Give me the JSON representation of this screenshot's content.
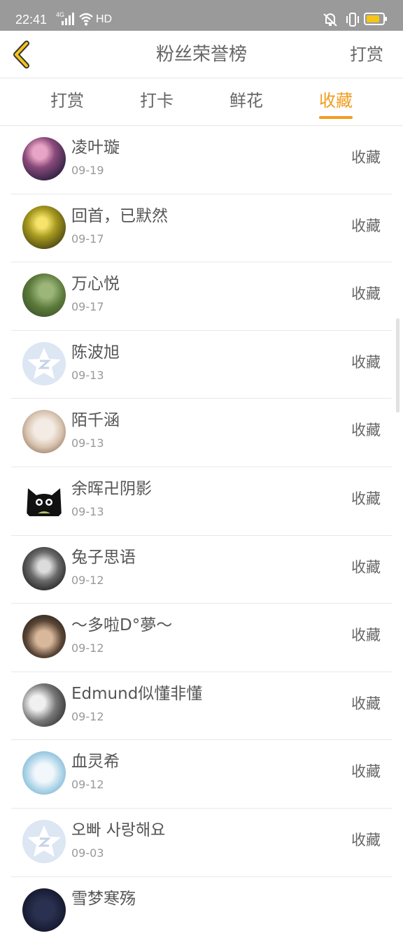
{
  "status": {
    "time": "22:41",
    "network": "4G",
    "hd": "HD"
  },
  "header": {
    "title": "粉丝荣誉榜",
    "action": "打赏"
  },
  "tabs": [
    {
      "label": "打赏",
      "active": false
    },
    {
      "label": "打卡",
      "active": false
    },
    {
      "label": "鲜花",
      "active": false
    },
    {
      "label": "收藏",
      "active": true
    }
  ],
  "colors": {
    "accent": "#f29c1f",
    "statusbar": "#9a9a9a"
  },
  "fans": [
    {
      "name": "凌叶璇",
      "date": "09-19",
      "type": "收藏"
    },
    {
      "name": "回首，已默然",
      "date": "09-17",
      "type": "收藏"
    },
    {
      "name": "万心悦",
      "date": "09-17",
      "type": "收藏"
    },
    {
      "name": "陈波旭",
      "date": "09-13",
      "type": "收藏"
    },
    {
      "name": "陌千涵",
      "date": "09-13",
      "type": "收藏"
    },
    {
      "name": "余晖卍阴影",
      "date": "09-13",
      "type": "收藏"
    },
    {
      "name": "兔子思语",
      "date": "09-12",
      "type": "收藏"
    },
    {
      "name": "～多啦D°夢～",
      "date": "09-12",
      "type": "收藏"
    },
    {
      "name": "Edmund似懂非懂",
      "date": "09-12",
      "type": "收藏"
    },
    {
      "name": "血灵希",
      "date": "09-12",
      "type": "收藏"
    },
    {
      "name": "오빠 사랑해요",
      "date": "09-03",
      "type": "收藏"
    },
    {
      "name": "雪梦寒殇",
      "date": "",
      "type": ""
    }
  ]
}
